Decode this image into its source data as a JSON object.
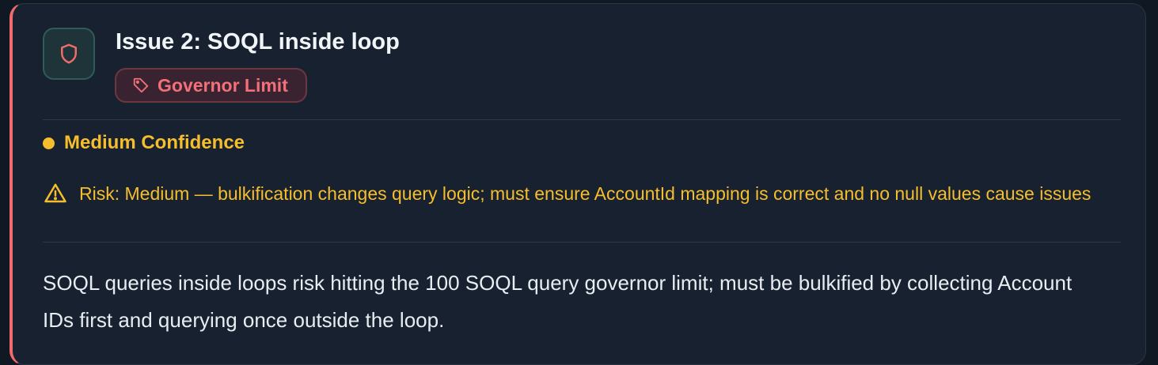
{
  "issue": {
    "title": "Issue 2: SOQL inside loop",
    "icon": "shield-icon",
    "tag": {
      "icon": "tag-icon",
      "label": "Governor Limit"
    },
    "confidence": {
      "label": "Medium Confidence"
    },
    "risk": {
      "icon": "warning-triangle-icon",
      "text": "Risk: Medium — bulkification changes query logic; must ensure AccountId mapping is correct and no null values cause issues"
    },
    "description": "SOQL queries inside loops risk hitting the 100 SOQL query governor limit; must be bulkified by collecting Account IDs first and querying once outside the loop."
  },
  "colors": {
    "accent_left_border": "#f06b6b",
    "tag_text": "#f1707a",
    "confidence": "#f6be2c",
    "card_background": "#17212f",
    "icon_box_background": "#1e3438"
  }
}
